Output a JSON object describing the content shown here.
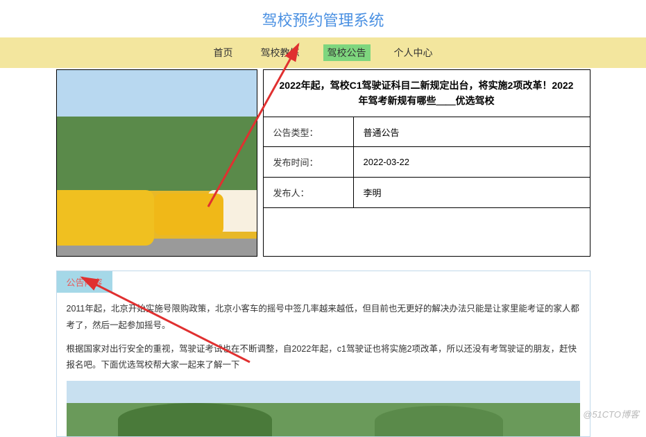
{
  "header": {
    "title": "驾校预约管理系统"
  },
  "nav": {
    "items": [
      {
        "label": "首页",
        "name": "nav-home"
      },
      {
        "label": "驾校教练",
        "name": "nav-coach"
      },
      {
        "label": "驾校公告",
        "name": "nav-notice",
        "active": true
      },
      {
        "label": "个人中心",
        "name": "nav-profile"
      }
    ]
  },
  "notice": {
    "title": "2022年起，驾校C1驾驶证科目二新规定出台，将实施2项改革！2022年驾考新规有哪些＿＿优选驾校",
    "rows": [
      {
        "label": "公告类型：",
        "value": "普通公告"
      },
      {
        "label": "发布时间：",
        "value": "2022-03-22"
      },
      {
        "label": "发布人：",
        "value": "李明"
      }
    ]
  },
  "content": {
    "tab": "公告内容",
    "paragraphs": [
      "2011年起，北京开始实施号限购政策，北京小客车的摇号中签几率越来越低，但目前也无更好的解决办法只能是让家里能考证的家人都考了，然后一起参加摇号。",
      "根据国家对出行安全的重视，驾驶证考试也在不断调整，自2022年起，c1驾驶证也将实施2项改革，所以还没有考驾驶证的朋友，赶快报名吧。下面优选驾校帮大家一起来了解一下"
    ]
  },
  "watermark": "@51CTO博客"
}
